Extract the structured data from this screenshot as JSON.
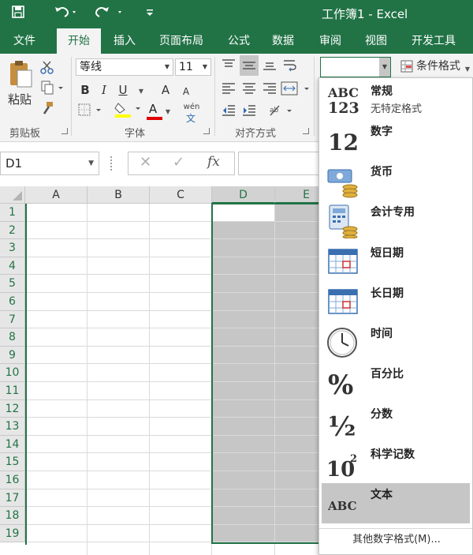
{
  "window": {
    "title": "工作簿1 - Excel"
  },
  "quick_access": {
    "save": "save-icon",
    "undo": "undo-icon",
    "redo": "redo-icon",
    "customize": "customize-icon"
  },
  "tabs": [
    "文件",
    "开始",
    "插入",
    "页面布局",
    "公式",
    "数据",
    "审阅",
    "视图",
    "开发工具"
  ],
  "active_tab": "开始",
  "ribbon": {
    "clipboard": {
      "paste_label": "粘贴",
      "group_label": "剪贴板"
    },
    "font": {
      "font_name": "等线",
      "font_size": "11",
      "bold": "B",
      "italic": "I",
      "underline": "U",
      "grow": "A",
      "shrink": "A",
      "font_color_letter": "A",
      "phonetic": "wén",
      "group_label": "字体"
    },
    "alignment": {
      "group_label": "对齐方式"
    },
    "number_format_value": "",
    "conditional_format_label": "条件格式"
  },
  "formula_bar": {
    "name_box": "D1",
    "cancel": "✕",
    "enter": "✓",
    "fx": "fx",
    "formula": ""
  },
  "grid": {
    "columns": [
      "A",
      "B",
      "C",
      "D",
      "E"
    ],
    "rows": [
      "1",
      "2",
      "3",
      "4",
      "5",
      "6",
      "7",
      "8",
      "9",
      "10",
      "11",
      "12",
      "13",
      "14",
      "15",
      "16",
      "17",
      "18",
      "19"
    ],
    "active_cell": "D1"
  },
  "number_format_menu": {
    "items": [
      {
        "label": "常规",
        "sub": "无特定格式",
        "icon": "general-format-icon",
        "icon_text": "ABC",
        "icon_text2": "123"
      },
      {
        "label": "数字",
        "sub": "",
        "icon": "number-format-icon",
        "icon_text": "12"
      },
      {
        "label": "货币",
        "sub": "",
        "icon": "currency-format-icon"
      },
      {
        "label": "会计专用",
        "sub": "",
        "icon": "accounting-format-icon"
      },
      {
        "label": "短日期",
        "sub": "",
        "icon": "short-date-icon"
      },
      {
        "label": "长日期",
        "sub": "",
        "icon": "long-date-icon"
      },
      {
        "label": "时间",
        "sub": "",
        "icon": "clock-icon"
      },
      {
        "label": "百分比",
        "sub": "",
        "icon": "percent-icon",
        "icon_text": "%"
      },
      {
        "label": "分数",
        "sub": "",
        "icon": "fraction-icon",
        "icon_text": "½"
      },
      {
        "label": "科学记数",
        "sub": "",
        "icon": "scientific-icon",
        "icon_text": "10",
        "icon_text2": "2"
      },
      {
        "label": "文本",
        "sub": "",
        "icon": "text-format-icon",
        "icon_text": "ABC"
      }
    ],
    "highlighted": "文本",
    "more_label": "其他数字格式(M)..."
  },
  "colors": {
    "excel_green": "#217346",
    "selection_gray": "#c6c6c6",
    "ribbon_bg": "#f3f3f3"
  }
}
